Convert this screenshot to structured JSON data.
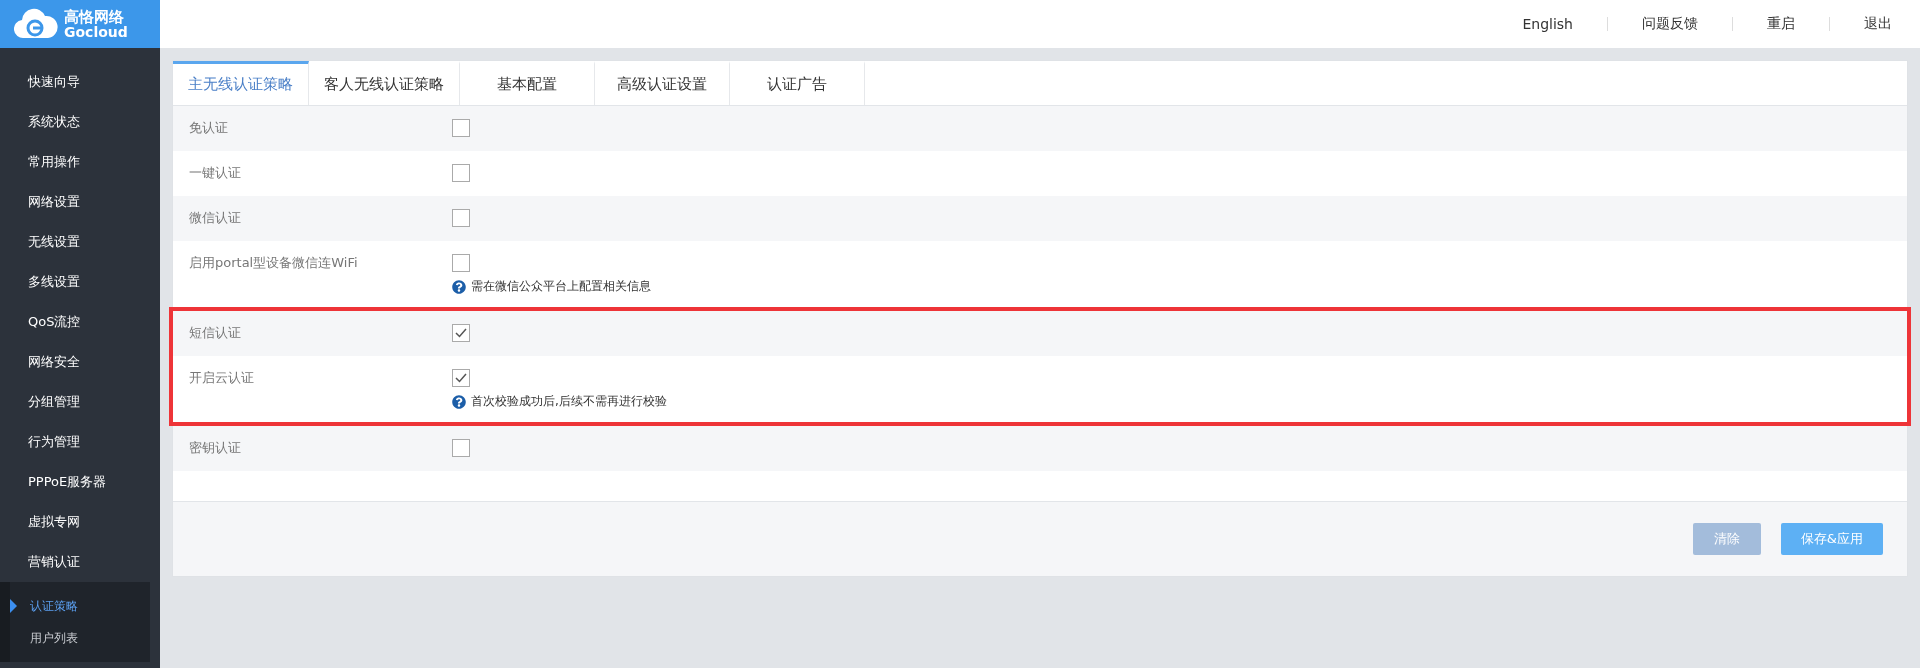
{
  "logo": {
    "name": "高恪网络",
    "brand": "Gocloud"
  },
  "top_links": [
    "English",
    "问题反馈",
    "重启",
    "退出"
  ],
  "sidebar": {
    "items": [
      {
        "label": "快速向导"
      },
      {
        "label": "系统状态"
      },
      {
        "label": "常用操作"
      },
      {
        "label": "网络设置"
      },
      {
        "label": "无线设置"
      },
      {
        "label": "多线设置"
      },
      {
        "label": "QoS流控"
      },
      {
        "label": "网络安全"
      },
      {
        "label": "分组管理"
      },
      {
        "label": "行为管理"
      },
      {
        "label": "PPPoE服务器"
      },
      {
        "label": "虚拟专网"
      },
      {
        "label": "营销认证",
        "children": [
          {
            "label": "认证策略",
            "selected": true
          },
          {
            "label": "用户列表",
            "selected": false
          }
        ]
      }
    ]
  },
  "tabs": [
    {
      "label": "主无线认证策略",
      "selected": true
    },
    {
      "label": "客人无线认证策略",
      "selected": false
    },
    {
      "label": "基本配置",
      "selected": false
    },
    {
      "label": "高级认证设置",
      "selected": false
    },
    {
      "label": "认证广告",
      "selected": false
    }
  ],
  "settings": [
    {
      "label": "免认证",
      "checked": false,
      "highlighted": false
    },
    {
      "label": "一键认证",
      "checked": false,
      "highlighted": false
    },
    {
      "label": "微信认证",
      "checked": false,
      "highlighted": false
    },
    {
      "label": "启用portal型设备微信连WiFi",
      "checked": false,
      "highlighted": false,
      "hint": "需在微信公众平台上配置相关信息"
    },
    {
      "label": "短信认证",
      "checked": true,
      "highlighted": true
    },
    {
      "label": "开启云认证",
      "checked": true,
      "highlighted": true,
      "hint": "首次校验成功后,后续不需再进行校验"
    },
    {
      "label": "密钥认证",
      "checked": false,
      "highlighted": false
    }
  ],
  "buttons": [
    {
      "label": "清除",
      "disabled": true
    },
    {
      "label": "保存&应用",
      "disabled": false
    }
  ]
}
